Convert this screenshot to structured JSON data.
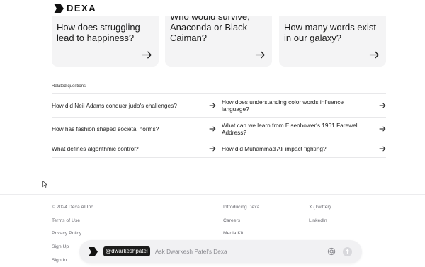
{
  "header": {
    "brand": "DEXA"
  },
  "cards": [
    {
      "title": "How does struggling lead to happiness?"
    },
    {
      "title": "Who would survive, Anaconda or Black Caiman?"
    },
    {
      "title": "How many words exist in our galaxy?"
    }
  ],
  "related": {
    "heading": "Related questions",
    "rows": [
      {
        "left": "How did Neil Adams conquer judo's challenges?",
        "right": "How does understanding color words influence language?"
      },
      {
        "left": "How has fashion shaped societal norms?",
        "right": "What can we learn from Eisenhower's 1961 Farewell Address?"
      },
      {
        "left": "What defines algorithmic control?",
        "right": "How did Muhammad Ali impact fighting?"
      }
    ]
  },
  "footer": {
    "col1": [
      "© 2024 Dexa AI Inc.",
      "Terms of Use",
      "Privacy Policy",
      "Sign Up",
      "Sign In"
    ],
    "col2": [
      "Introducing Dexa",
      "Careers",
      "Media Kit"
    ],
    "col3": [
      "X (Twitter)",
      "LinkedIn"
    ]
  },
  "chat": {
    "mention": "@dwarkeshpatel",
    "placeholder": "Ask Dwarkesh Patel's Dexa"
  }
}
